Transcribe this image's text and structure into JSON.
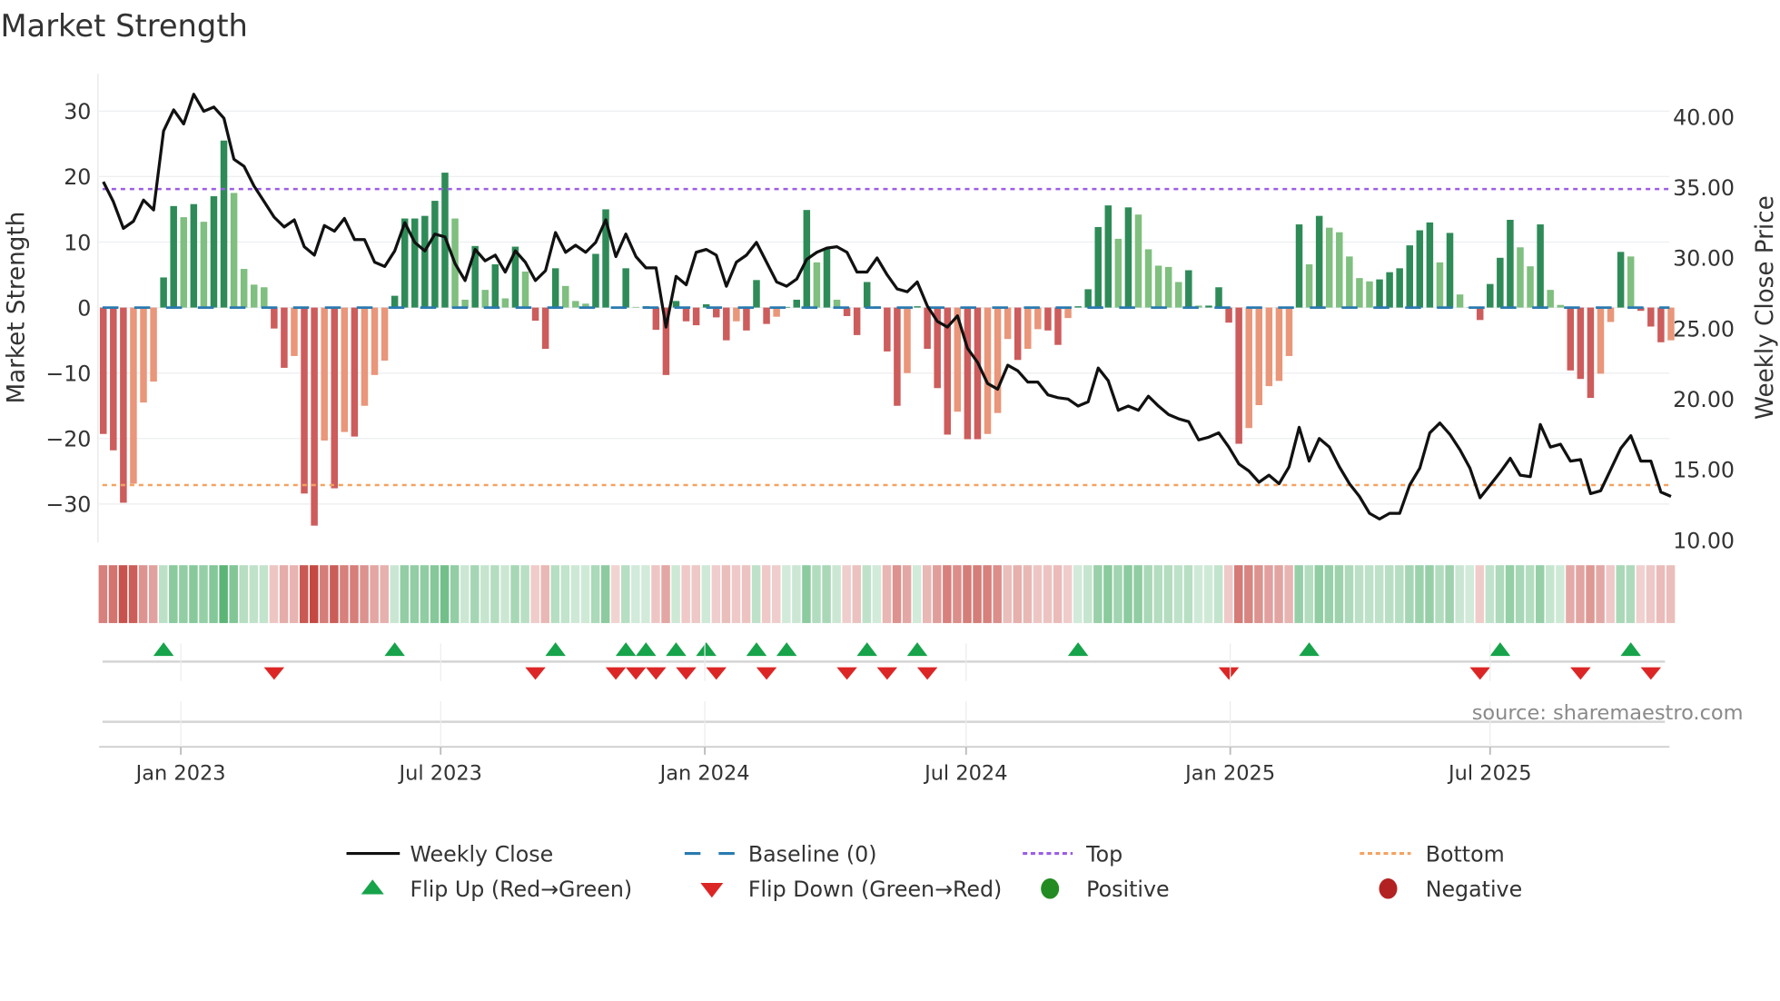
{
  "title": "Market Strength",
  "source": "source: sharemaestro.com",
  "legend": {
    "weekly_close": "Weekly Close",
    "baseline": "Baseline (0)",
    "top": "Top",
    "bottom": "Bottom",
    "flip_up": "Flip Up (Red→Green)",
    "flip_down": "Flip Down (Green→Red)",
    "positive": "Positive",
    "negative": "Negative"
  },
  "colors": {
    "up_strong": "#2e8b57",
    "up_weak": "#7fbf7f",
    "down_strong": "#cd5c5c",
    "down_weak": "#e9967a",
    "close_line": "#111111",
    "baseline": "#2a7ab0",
    "top": "#9b5de5",
    "bottom": "#f4a261",
    "flip_up": "#16a34a",
    "flip_down": "#dc2626",
    "positive": "#228b22",
    "negative": "#b22222"
  },
  "chart_data": {
    "type": "bar",
    "title": "Market Strength",
    "ylabel": "Market Strength",
    "y2label": "Weekly Close Price",
    "ylim": [
      -36,
      36
    ],
    "y2lim": [
      8.5,
      42.5
    ],
    "yticks": [
      "30",
      "20",
      "10",
      "0",
      "−10",
      "−20",
      "−30"
    ],
    "ytick_values": [
      30,
      20,
      10,
      0,
      -10,
      -20,
      -30
    ],
    "y2ticks": [
      "40.00",
      "35.00",
      "30.00",
      "25.00",
      "20.00",
      "15.00",
      "10.00"
    ],
    "y2tick_values": [
      40,
      35,
      30,
      25,
      20,
      15,
      10
    ],
    "xticks": [
      "Jan 2023",
      "Jul 2023",
      "Jan 2024",
      "Jul 2024",
      "Jan 2025",
      "Jul 2025"
    ],
    "xtick_dates": [
      "2023-01-01",
      "2023-07-01",
      "2024-01-01",
      "2024-07-01",
      "2025-01-01",
      "2025-07-01"
    ],
    "x_start": "2022-11-08",
    "x_step_days": 7,
    "grid": true,
    "legend_position": "bottom",
    "top_level": 18.1,
    "bottom_level": -27.1,
    "baseline": 0,
    "strength": [
      -19.3,
      -21.8,
      -29.8,
      -26.9,
      -14.5,
      -11.3,
      4.6,
      15.5,
      13.8,
      15.8,
      13.1,
      17.0,
      25.5,
      17.5,
      5.9,
      3.5,
      3.1,
      -3.2,
      -9.2,
      -7.4,
      -28.4,
      -33.3,
      -20.3,
      -27.6,
      -19.0,
      -19.7,
      -15.0,
      -10.3,
      -8.1,
      1.8,
      13.6,
      13.6,
      14.0,
      16.3,
      20.6,
      13.6,
      1.2,
      9.4,
      2.7,
      6.6,
      1.4,
      9.3,
      5.5,
      -2.0,
      -6.3,
      6.0,
      3.3,
      1.0,
      0.6,
      8.2,
      15.0,
      -0.1,
      6.0,
      0.1,
      0.2,
      -3.4,
      -10.3,
      1.0,
      -2.1,
      -2.7,
      0.5,
      -1.5,
      -5.0,
      -2.1,
      -3.5,
      4.2,
      -2.5,
      -1.4,
      0.1,
      1.2,
      14.9,
      6.9,
      8.9,
      1.2,
      -1.3,
      -4.2,
      3.9,
      0.2,
      -6.7,
      -15.0,
      -10.0,
      0.2,
      -6.3,
      -12.3,
      -19.4,
      -15.9,
      -20.1,
      -20.1,
      -19.3,
      -16.1,
      -4.8,
      -8.0,
      -6.3,
      -3.3,
      -3.5,
      -5.7,
      -1.6,
      0.2,
      2.8,
      12.3,
      15.6,
      10.5,
      15.3,
      14.2,
      8.9,
      6.4,
      6.2,
      3.9,
      5.7,
      0.3,
      0.3,
      3.1,
      -2.3,
      -20.8,
      -18.4,
      -14.9,
      -12.0,
      -11.2,
      -7.4,
      12.7,
      6.6,
      14.0,
      12.2,
      11.5,
      7.8,
      4.5,
      4.0,
      4.3,
      5.4,
      6.0,
      9.5,
      11.8,
      13.0,
      6.9,
      11.4,
      2.0,
      0.1,
      -1.9,
      3.6,
      7.6,
      13.4,
      9.2,
      6.3,
      12.7,
      2.7,
      0.4,
      -9.6,
      -10.9,
      -13.8,
      -10.1,
      -2.2,
      8.5,
      7.8,
      -0.5,
      -2.9,
      -5.3,
      -5.0
    ],
    "weekly_close": [
      35.4,
      34.0,
      32.1,
      32.6,
      34.1,
      33.4,
      39.0,
      40.5,
      39.5,
      41.6,
      40.4,
      40.7,
      39.9,
      37.0,
      36.5,
      35.1,
      34.0,
      32.9,
      32.2,
      32.7,
      30.8,
      30.2,
      32.3,
      31.9,
      32.8,
      31.3,
      31.3,
      29.7,
      29.4,
      30.5,
      32.5,
      31.1,
      30.5,
      31.7,
      31.5,
      29.6,
      28.4,
      30.6,
      29.8,
      30.2,
      29.0,
      30.5,
      29.7,
      28.4,
      29.1,
      31.8,
      30.4,
      30.9,
      30.4,
      31.1,
      32.7,
      30.1,
      31.7,
      30.1,
      29.3,
      29.3,
      25.1,
      28.7,
      28.1,
      30.4,
      30.6,
      30.2,
      28.0,
      29.7,
      30.2,
      31.1,
      29.7,
      28.3,
      28.0,
      28.5,
      29.9,
      30.4,
      30.7,
      30.8,
      30.4,
      29.0,
      29.0,
      30.0,
      28.8,
      27.8,
      27.6,
      28.3,
      26.6,
      25.5,
      25.1,
      25.9,
      23.6,
      22.6,
      21.1,
      20.7,
      22.4,
      22.0,
      21.2,
      21.2,
      20.3,
      20.1,
      20.0,
      19.5,
      19.8,
      22.2,
      21.3,
      19.2,
      19.5,
      19.2,
      20.2,
      19.5,
      18.9,
      18.6,
      18.4,
      17.1,
      17.3,
      17.6,
      16.6,
      15.4,
      14.9,
      14.1,
      14.6,
      14.0,
      15.2,
      18.0,
      15.6,
      17.2,
      16.6,
      15.2,
      14.0,
      13.1,
      11.9,
      11.5,
      11.9,
      11.9,
      13.9,
      15.1,
      17.6,
      18.3,
      17.5,
      16.4,
      15.1,
      13.0,
      13.9,
      14.8,
      15.8,
      14.6,
      14.5,
      18.2,
      16.6,
      16.8,
      15.6,
      15.7,
      13.3,
      13.5,
      15.0,
      16.5,
      17.4,
      15.6,
      15.6,
      13.4,
      13.1
    ],
    "flip_up_weeks": [
      6,
      29,
      45,
      52,
      54,
      57,
      60,
      65,
      68,
      76,
      81,
      97,
      120,
      139,
      152
    ],
    "flip_down_weeks": [
      17,
      43,
      51,
      53,
      55,
      58,
      61,
      66,
      74,
      78,
      82,
      112,
      137,
      147,
      154
    ]
  }
}
